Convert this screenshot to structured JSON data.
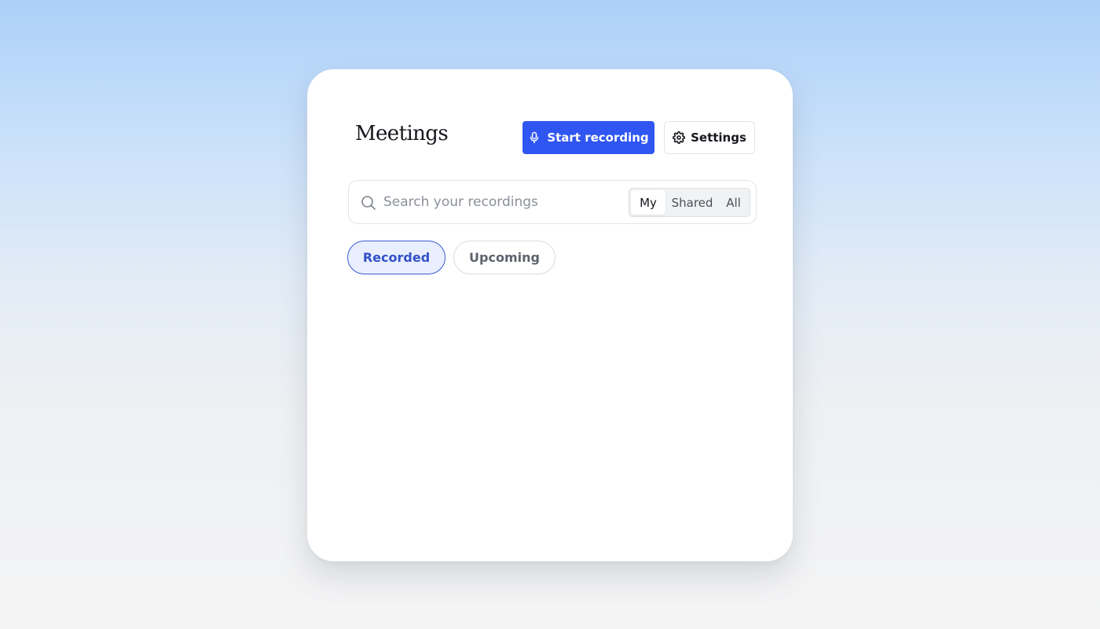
{
  "header": {
    "title": "Meetings",
    "start_recording_label": "Start recording",
    "settings_label": "Settings"
  },
  "search": {
    "placeholder": "Search your recordings",
    "value": ""
  },
  "scope_filter": {
    "options": [
      "My",
      "Shared",
      "All"
    ],
    "selected": "My"
  },
  "tabs": [
    {
      "label": "Recorded",
      "active": true
    },
    {
      "label": "Upcoming",
      "active": false
    }
  ],
  "icons": {
    "start_recording": "microphone-icon",
    "settings": "gear-icon",
    "search": "search-icon"
  },
  "colors": {
    "primary": "#3056f2",
    "active_tab_text": "#3350c8",
    "active_tab_background": "#e9efff"
  }
}
